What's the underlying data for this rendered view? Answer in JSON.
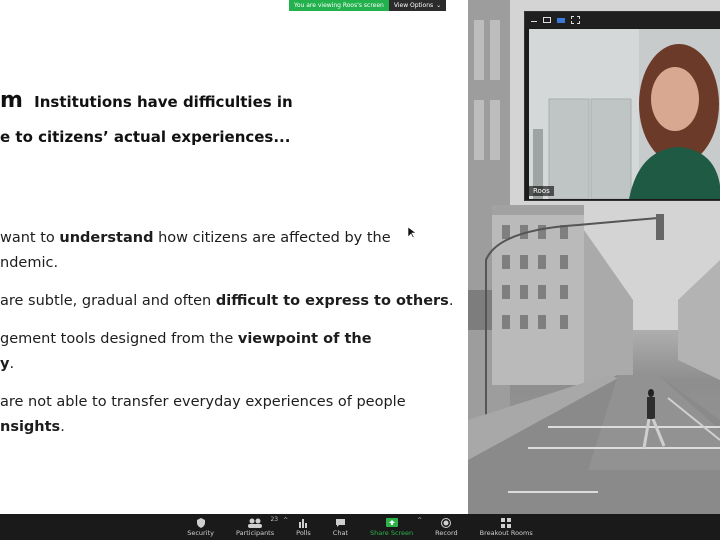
{
  "banner": {
    "viewing_text": "You are viewing Roos's screen",
    "options_label": "View Options"
  },
  "slide": {
    "title_line_1_prefix": "m",
    "title_line_1": "Institutions have difficulties in",
    "title_line_2": "e to citizens’ actual experiences...",
    "bullets": [
      {
        "a": "want to ",
        "b": "understand",
        "c": " how citizens are affected by the"
      },
      {
        "a": "ndemic.",
        "b": "",
        "c": ""
      },
      {
        "a": "are subtle, gradual and often ",
        "b": "difficult to express to others",
        "c": "."
      },
      {
        "a": "gement tools designed from the ",
        "b": "viewpoint of the",
        "c": ""
      },
      {
        "a": "",
        "b": "y",
        "c": "."
      },
      {
        "a": "are not able to transfer everyday experiences of people",
        "b": "",
        "c": ""
      },
      {
        "a": "",
        "b": "nsights",
        "c": "."
      }
    ]
  },
  "video": {
    "participant_name": "Roos"
  },
  "toolbar": {
    "security": "Security",
    "participants": "Participants",
    "participants_count": "23",
    "polls": "Polls",
    "chat": "Chat",
    "share_screen": "Share Screen",
    "record": "Record",
    "breakout_rooms": "Breakout Rooms"
  },
  "colors": {
    "share_green": "#2db34a",
    "banner_green": "#23b14d",
    "toolbar_bg": "#1a1a1a"
  }
}
